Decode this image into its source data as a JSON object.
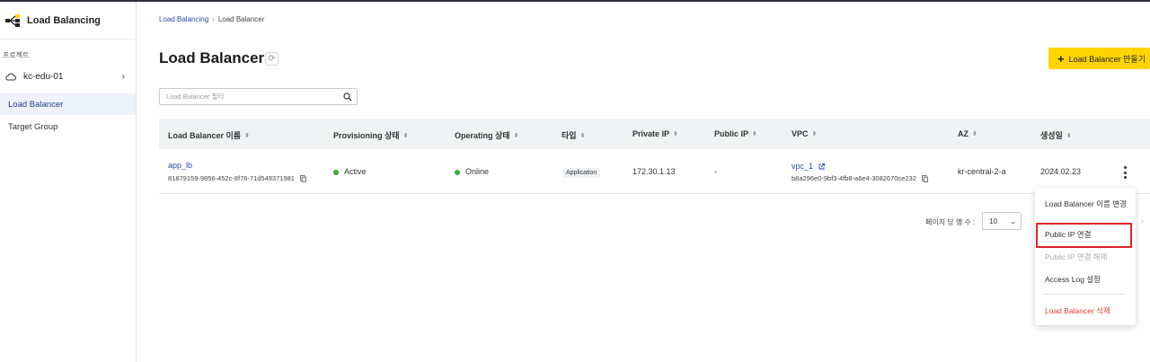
{
  "app": {
    "title": "Load Balancing"
  },
  "sidebar": {
    "section_label": "프로젝트",
    "project": "kc-edu-01",
    "items": [
      {
        "label": "Load Balancer",
        "active": true
      },
      {
        "label": "Target Group",
        "active": false
      }
    ]
  },
  "breadcrumb": {
    "parent": "Load Balancing",
    "current": "Load Balancer"
  },
  "header": {
    "title": "Load Balancer",
    "create_button": "Load Balancer 만들기"
  },
  "search": {
    "placeholder": "Load Balancer 필터"
  },
  "table": {
    "columns": [
      "Load Balancer 이름",
      "Provisioning 상태",
      "Operating 상태",
      "타입",
      "Private IP",
      "Public IP",
      "VPC",
      "AZ",
      "생성일"
    ],
    "rows": [
      {
        "name": "app_lb",
        "id": "81879159-9856-452c-8f76-71d549371981",
        "provisioning": "Active",
        "operating": "Online",
        "type": "Application",
        "private_ip": "172.30.1.13",
        "public_ip": "-",
        "vpc": "vpc_1",
        "vpc_id": "b8a296e0-9bf3-4fb8-a6e4-3082670ce232",
        "az": "kr-central-2-a",
        "created": "2024.02.23"
      }
    ]
  },
  "pagination": {
    "rows_per_page_label": "페이지 당 행 수 :",
    "rows_per_page": "10"
  },
  "menu": {
    "items": [
      {
        "label": "Load Balancer 이름 변경",
        "state": "normal"
      },
      {
        "label": "Public IP 연결",
        "state": "highlighted"
      },
      {
        "label": "Public IP 연결 해제",
        "state": "disabled"
      },
      {
        "label": "Access Log 설정",
        "state": "normal"
      },
      {
        "label": "Load Balancer 삭제",
        "state": "danger"
      }
    ]
  },
  "colors": {
    "accent": "#ffd400",
    "link": "#2b4ea2",
    "status_ok": "#3aa93a",
    "danger": "#e04236",
    "highlight_box": "#e0242c"
  }
}
